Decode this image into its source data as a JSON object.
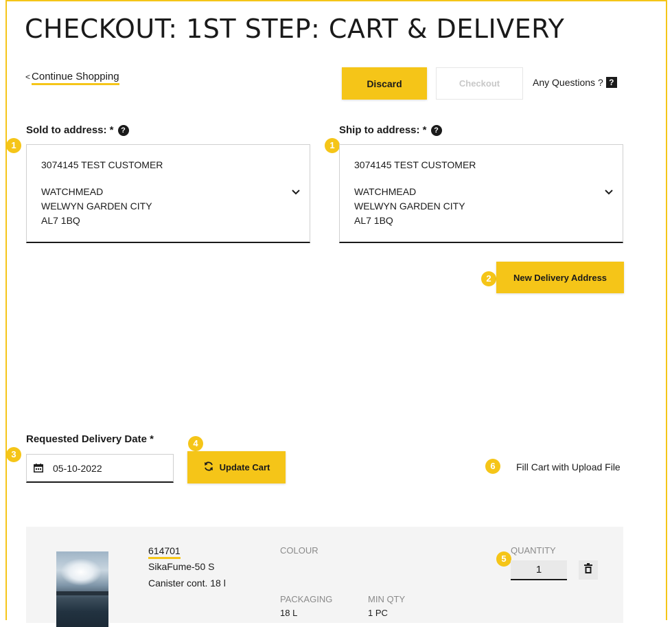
{
  "page": {
    "title": "CHECKOUT: 1ST STEP: CART & DELIVERY"
  },
  "nav": {
    "continue_prefix": "<",
    "continue_label": "Continue Shopping"
  },
  "actions": {
    "discard_label": "Discard",
    "checkout_label": "Checkout",
    "questions_label": "Any Questions ?",
    "questions_icon": "?"
  },
  "sold_to": {
    "label": "Sold to address: *",
    "help_icon": "?",
    "name": "3074145 TEST CUSTOMER",
    "line1": "WATCHMEAD",
    "line2": "WELWYN GARDEN CITY",
    "line3": "AL7 1BQ"
  },
  "ship_to": {
    "label": "Ship to address: *",
    "help_icon": "?",
    "name": "3074145 TEST CUSTOMER",
    "line1": "WATCHMEAD",
    "line2": "WELWYN GARDEN CITY",
    "line3": "AL7 1BQ"
  },
  "new_delivery": {
    "label": "New Delivery Address"
  },
  "delivery_date": {
    "label": "Requested Delivery Date *",
    "value": "05-10-2022"
  },
  "update_cart": {
    "label": "Update Cart"
  },
  "fill_cart": {
    "label": "Fill Cart with Upload File"
  },
  "badges": {
    "b1": "1",
    "b2": "2",
    "b3": "3",
    "b4": "4",
    "b5": "5",
    "b6": "6"
  },
  "cart_item": {
    "sku": "614701",
    "name": "SikaFume-50 S",
    "description": "Canister cont. 18 l",
    "colour_label": "COLOUR",
    "packaging_label": "PACKAGING",
    "packaging_value": "18 L",
    "min_qty_label": "MIN QTY",
    "min_qty_value": "1 PC",
    "quantity_label": "QUANTITY",
    "quantity_value": "1"
  },
  "colors": {
    "accent": "#f5c518",
    "text": "#1a1a1a",
    "muted": "#8a8a8a"
  }
}
